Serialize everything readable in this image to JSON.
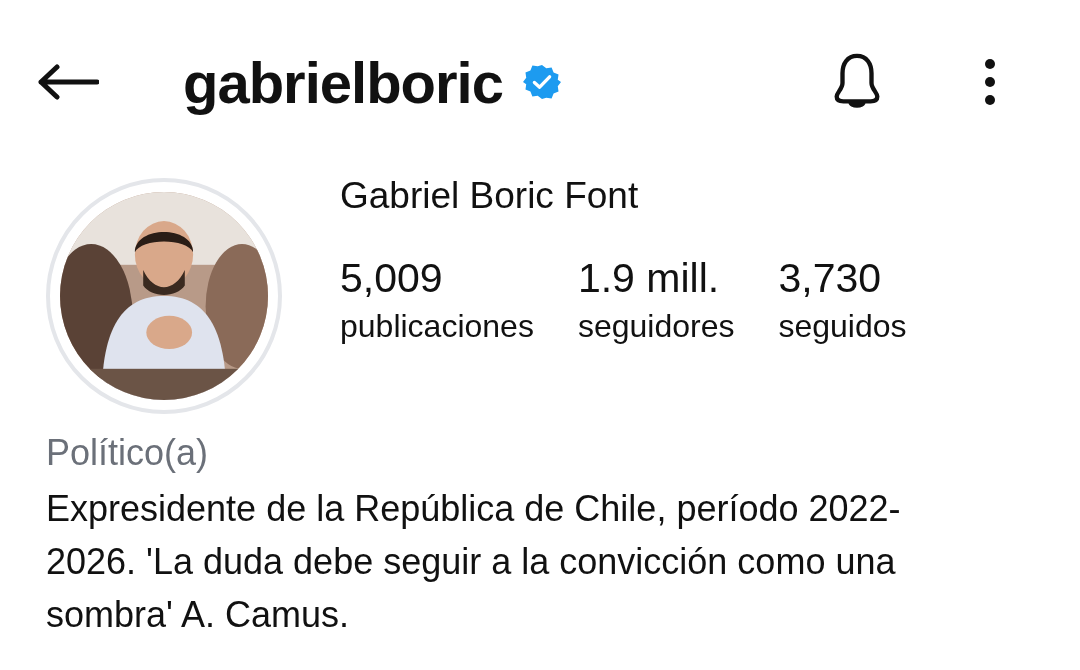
{
  "header": {
    "username": "gabrielboric",
    "verified": true
  },
  "profile": {
    "name": "Gabriel Boric Font",
    "stats": [
      {
        "count": "5,009",
        "label": "publicaciones"
      },
      {
        "count": "1.9 mill.",
        "label": "seguidores"
      },
      {
        "count": "3,730",
        "label": "seguidos"
      }
    ],
    "category": "Político(a)",
    "bio": "Expresidente de la República de Chile, período 2022-2026. 'La duda debe seguir a la convicción como una sombra' A. Camus."
  }
}
